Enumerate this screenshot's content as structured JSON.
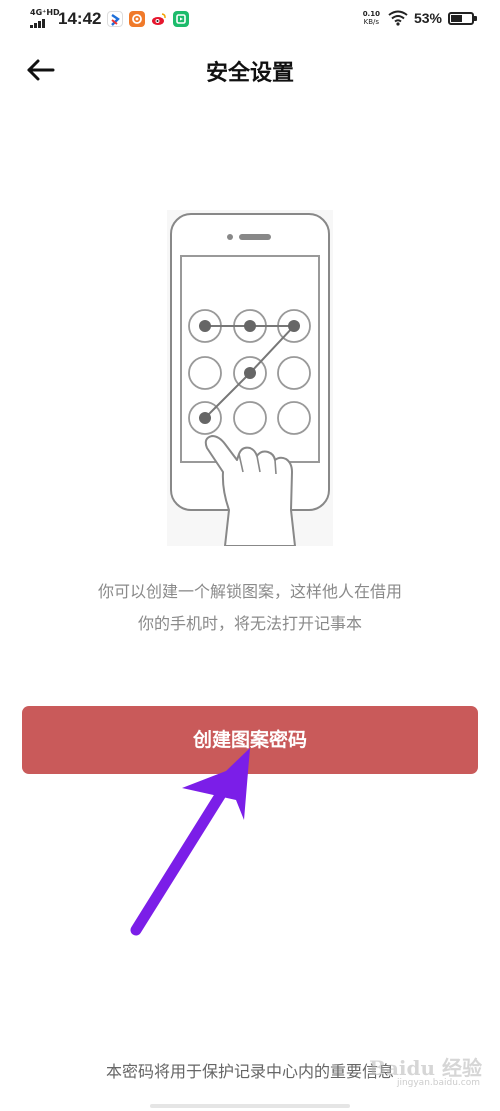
{
  "status_bar": {
    "network": "4G⁺HD",
    "time": "14:42",
    "apps": [
      {
        "icon": "app-icon-1",
        "color": "#ffffff"
      },
      {
        "icon": "app-icon-2",
        "color": "#f07a2a"
      },
      {
        "icon": "weibo-icon",
        "color": "#e6162d"
      },
      {
        "icon": "app-icon-4",
        "color": "#1dbb6b"
      }
    ],
    "net_speed_value": "0.10",
    "net_speed_unit": "KB/s",
    "battery_percent": "53%",
    "battery_level": 0.53
  },
  "header": {
    "title": "安全设置",
    "back_icon": "arrow-left-icon"
  },
  "illustration": {
    "icon": "phone-pattern-lock-illustration"
  },
  "description": {
    "line1": "你可以创建一个解锁图案，这样他人在借用",
    "line2": "你的手机时，将无法打开记事本"
  },
  "primary_button": {
    "label": "创建图案密码",
    "color": "#c95a5a"
  },
  "annotation": {
    "icon": "purple-arrow-annotation",
    "color": "#7b1ee8"
  },
  "footer": {
    "note": "本密码将用于保护记录中心内的重要信息"
  },
  "watermark": {
    "text": "Baidu 经验",
    "sub": "jingyan.baidu.com"
  }
}
